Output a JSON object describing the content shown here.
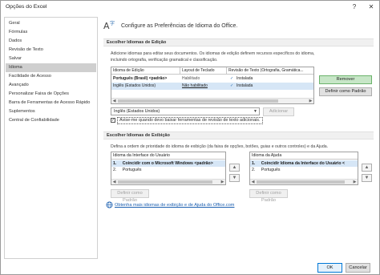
{
  "window": {
    "title": "Opções do Excel",
    "help_glyph": "?",
    "close_glyph": "✕"
  },
  "sidebar": {
    "items": [
      {
        "label": "Geral"
      },
      {
        "label": "Fórmulas"
      },
      {
        "label": "Dados"
      },
      {
        "label": "Revisão de Texto"
      },
      {
        "label": "Salvar"
      },
      {
        "label": "Idioma",
        "active": true
      },
      {
        "label": "Facilidade de Acesso"
      },
      {
        "label": "Avançado"
      },
      {
        "label": "Personalizar Faixa de Opções"
      },
      {
        "label": "Barra de Ferramentas de Acesso Rápido"
      },
      {
        "label": "Suplementos"
      },
      {
        "label": "Central de Confiabilidade"
      }
    ]
  },
  "main": {
    "heading": "Configure as Preferências de Idioma do Office.",
    "editing": {
      "section_title": "Escolher Idiomas de Edição",
      "description": "Adicione idiomas para editar seus documentos. Os idiomas de edição definem recursos específicos do idioma, incluindo ortografia, verificação gramatical e classificação.",
      "columns": [
        "Idioma de Edição",
        "Layout de Teclado",
        "Revisão de Texto (Ortografia, Gramática..."
      ],
      "rows": [
        {
          "language": "Português (Brasil) <padrão>",
          "keyboard": "Habilitado",
          "proofing": "Instalada"
        },
        {
          "language": "Inglês (Estados Unidos)",
          "keyboard": "Não habilitado",
          "proofing": "Instalada"
        }
      ],
      "remove_button": "Remover",
      "set_default_button": "Definir como Padrão",
      "add_select_value": "Inglês (Estados Unidos)",
      "add_button": "Adicionar",
      "notify_checkbox_label": "Avise-me quando devo baixar ferramentas de revisão de texto adicionais.",
      "notify_checked": true
    },
    "display": {
      "section_title": "Escolher Idiomas de Exibição",
      "description": "Defina a ordem de prioridade do idioma de exibição (da faixa de opções, botões, guias e outros controles) e da Ajuda.",
      "ui_list": {
        "header": "Idioma da Interface do Usuário",
        "items": [
          {
            "num": "1.",
            "label": "Coincidir com o Microsoft Windows <padrão>",
            "selected": true
          },
          {
            "num": "2.",
            "label": "Português",
            "selected": false
          }
        ]
      },
      "help_list": {
        "header": "Idioma da Ajuda",
        "items": [
          {
            "num": "1.",
            "label": "Coincidir Idioma da Interface do Usuário <",
            "selected": true
          },
          {
            "num": "2.",
            "label": "Português",
            "selected": false
          }
        ]
      },
      "set_default_ui": "Definir como Padrão",
      "set_default_help": "Definir como Padrão",
      "up_glyph": "▲",
      "down_glyph": "▼"
    },
    "link_text": "Obtenha mais idiomas de exibição e de Ajuda do Office.com"
  },
  "footer": {
    "ok": "OK",
    "cancel": "Cancelar"
  },
  "colors": {
    "accent": "#0078d7",
    "selected_row": "#d6e6f6",
    "link": "#1b5fb0"
  }
}
